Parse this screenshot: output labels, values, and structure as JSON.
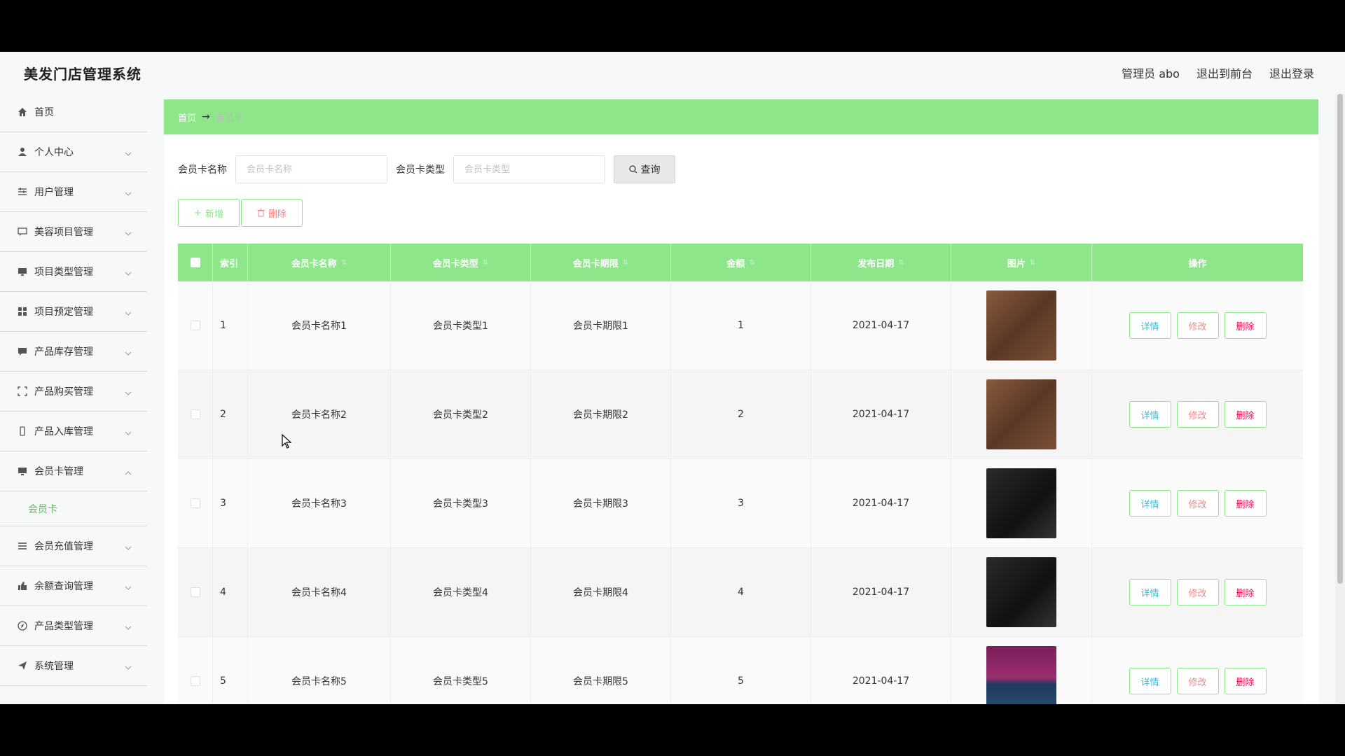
{
  "app": {
    "title": "美发门店管理系统"
  },
  "header": {
    "admin_label": "管理员 abo",
    "to_front": "退出到前台",
    "logout": "退出登录"
  },
  "sidebar": {
    "items": [
      {
        "label": "首页",
        "icon": "home-icon",
        "expanded": null
      },
      {
        "label": "个人中心",
        "icon": "user-icon",
        "expanded": false
      },
      {
        "label": "用户管理",
        "icon": "sliders-icon",
        "expanded": false
      },
      {
        "label": "美容项目管理",
        "icon": "chat-icon",
        "expanded": false
      },
      {
        "label": "项目类型管理",
        "icon": "monitor-icon",
        "expanded": false
      },
      {
        "label": "项目预定管理",
        "icon": "grid-icon",
        "expanded": false
      },
      {
        "label": "产品库存管理",
        "icon": "message-icon",
        "expanded": false
      },
      {
        "label": "产品购买管理",
        "icon": "fullscreen-icon",
        "expanded": false
      },
      {
        "label": "产品入库管理",
        "icon": "phone-icon",
        "expanded": false
      },
      {
        "label": "会员卡管理",
        "icon": "monitor-icon",
        "expanded": true
      },
      {
        "label": "会员充值管理",
        "icon": "list-icon",
        "expanded": false
      },
      {
        "label": "余额查询管理",
        "icon": "thumb-icon",
        "expanded": false
      },
      {
        "label": "产品类型管理",
        "icon": "compass-icon",
        "expanded": false
      },
      {
        "label": "系统管理",
        "icon": "send-icon",
        "expanded": false
      }
    ],
    "sub_item": "会员卡"
  },
  "breadcrumb": {
    "home": "首页",
    "arrow": "→",
    "current": "会员卡"
  },
  "search": {
    "name_label": "会员卡名称",
    "name_placeholder": "会员卡名称",
    "type_label": "会员卡类型",
    "type_placeholder": "会员卡类型",
    "query_button": "查询"
  },
  "actions": {
    "add": "新增",
    "delete": "删除"
  },
  "table": {
    "headers": [
      "索引",
      "会员卡名称",
      "会员卡类型",
      "会员卡期限",
      "金额",
      "发布日期",
      "图片",
      "操作"
    ],
    "rows": [
      {
        "index": "1",
        "name": "会员卡名称1",
        "type": "会员卡类型1",
        "term": "会员卡期限1",
        "amount": "1",
        "date": "2021-04-17",
        "image": "a"
      },
      {
        "index": "2",
        "name": "会员卡名称2",
        "type": "会员卡类型2",
        "term": "会员卡期限2",
        "amount": "2",
        "date": "2021-04-17",
        "image": "a"
      },
      {
        "index": "3",
        "name": "会员卡名称3",
        "type": "会员卡类型3",
        "term": "会员卡期限3",
        "amount": "3",
        "date": "2021-04-17",
        "image": "b"
      },
      {
        "index": "4",
        "name": "会员卡名称4",
        "type": "会员卡类型4",
        "term": "会员卡期限4",
        "amount": "4",
        "date": "2021-04-17",
        "image": "b"
      },
      {
        "index": "5",
        "name": "会员卡名称5",
        "type": "会员卡类型5",
        "term": "会员卡期限5",
        "amount": "5",
        "date": "2021-04-17",
        "image": "c"
      }
    ],
    "op_labels": {
      "detail": "详情",
      "edit": "修改",
      "delete": "删除"
    }
  },
  "colors": {
    "accent": "#8ee68a",
    "submenu_active": "#5cb85c",
    "detail": "#3cbdd6",
    "danger": "#e88"
  }
}
